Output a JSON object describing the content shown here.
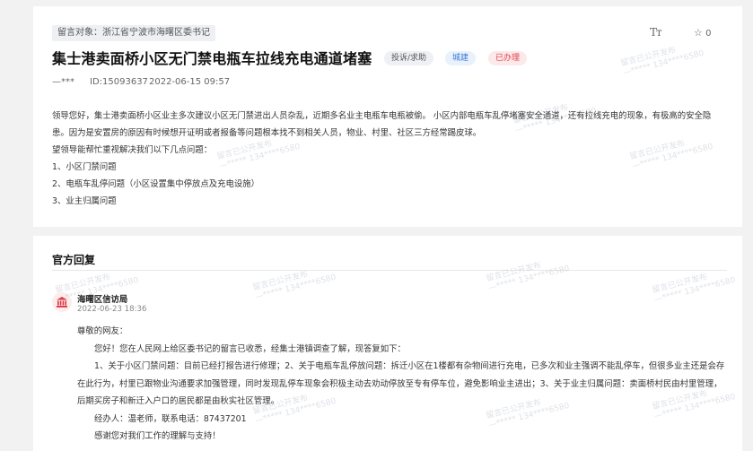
{
  "message": {
    "recipient": "留言对象：浙江省宁波市海曙区委书记",
    "font_size_icon": "Tт",
    "favorite": {
      "icon": "star-outline-icon",
      "count": "0"
    },
    "title": "集士港卖面桥小区无门禁电瓶车拉线充电通道堵塞",
    "tags": {
      "type": "投诉/求助",
      "domain": "城建",
      "status": "已办理"
    },
    "author": "—***",
    "id": "ID:15093637",
    "date": "2022-06-15 09:57",
    "paragraphs": [
      "领导您好，集士港卖面桥小区业主多次建议小区无门禁进出人员杂乱，近期多名业主电瓶车电瓶被偷。 小区内部电瓶车乱停堵塞安全通道，还有拉线充电的现象，有极高的安全隐患。因为是安置房的原因有时候想开证明或者报备等问题根本找不到相关人员，物业、村里、社区三方经常踢皮球。",
      "望领导能帮忙重视解决我们以下几点问题：",
      "1、小区门禁问题",
      "2、电瓶车乱停问题（小区设置集中停放点及充电设施）",
      "3、业主归属问题"
    ]
  },
  "reply": {
    "heading": "官方回复",
    "department": "海曙区信访局",
    "department_icon": "government-building-icon",
    "date": "2022-06-23 18:36",
    "greeting": "尊敬的网友：",
    "intro": "您好！您在人民网上给区委书记的留言已收悉，经集士港镇调查了解，现答复如下：",
    "detail": "1、关于小区门禁问题：目前已经打报告进行修理；2、关于电瓶车乱停放问题：拆迁小区在1楼都有杂物间进行充电，已多次和业主强调不能乱停车，但很多业主还是会存在此行为，村里已跟物业沟通要求加强管理，同时发现乱停车现象会积极主动去劝动停放至专有停车位，避免影响业主进出；3、关于业主归属问题：卖面桥村民由村里管理，后期买房子和新迁入户口的居民都是由秋实社区管理。",
    "contact": "经办人：温老师，联系电话：87437201",
    "thanks": "感谢您对我们工作的理解与支持！"
  },
  "watermark": {
    "line1": "留言已公开发布",
    "line2": "—***** 134****6580"
  }
}
